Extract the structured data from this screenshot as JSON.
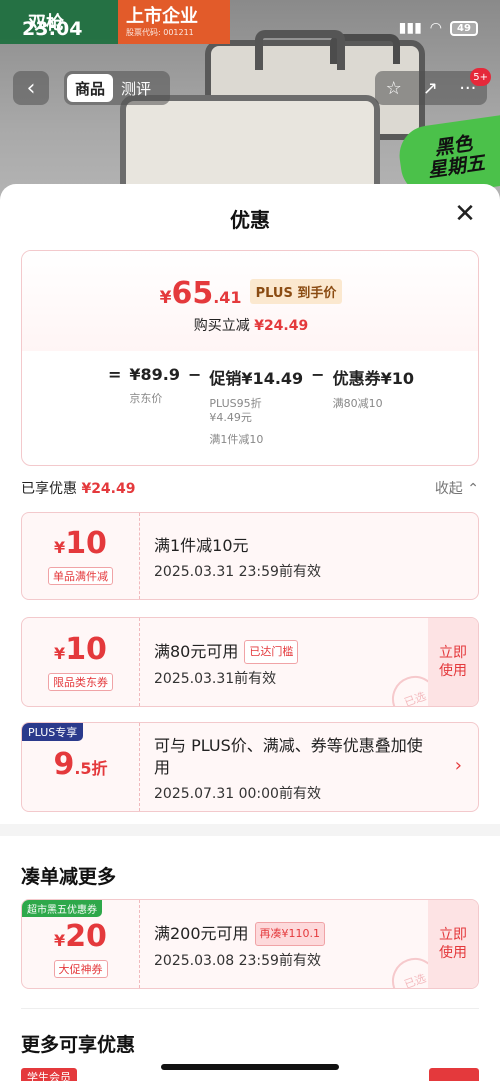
{
  "status": {
    "time": "23:04",
    "battery": "49"
  },
  "brand": {
    "name": "双枪",
    "listed": "上市企业",
    "stock_code": "股票代码: 001211"
  },
  "nav": {
    "tabs": [
      "商品",
      "测评"
    ],
    "badge": "5+"
  },
  "promo": {
    "line1": "黑色",
    "line2": "星期五"
  },
  "sheet": {
    "title": "优惠",
    "close": "✕"
  },
  "summary": {
    "final_cur": "¥",
    "final_int": "65",
    "final_dec": ".41",
    "plus_label": "PLUS 到手价",
    "instant_label": "购买立减",
    "instant_amount": "¥24.49",
    "formula": {
      "eq": "=",
      "price": "¥89.9",
      "price_label": "京东价",
      "minus1": "−",
      "promo": "促销¥14.49",
      "promo_sub1": "PLUS95折",
      "promo_sub2": "¥4.49元",
      "promo_sub3": "满1件减10",
      "minus2": "−",
      "coupon": "优惠券¥10",
      "coupon_sub": "满80减10"
    }
  },
  "enjoyed": {
    "label": "已享优惠",
    "amount": "¥24.49",
    "collapse": "收起 ⌃"
  },
  "coupons": [
    {
      "cur": "¥",
      "value": "10",
      "tag": "单品满件减",
      "main": "满1件减10元",
      "date": "2025.03.31 23:59前有效"
    },
    {
      "cur": "¥",
      "value": "10",
      "tag": "限品类东券",
      "main": "满80元可用",
      "reached": "已达门槛",
      "date": "2025.03.31前有效",
      "action": "立即使用",
      "stamp": "已选"
    },
    {
      "plus_badge": "PLUS专享",
      "value": "9",
      "suffix": ".5折",
      "main": "可与 PLUS价、满减、券等优惠叠加使用",
      "date": "2025.07.31 00:00前有效",
      "chevron": "›"
    }
  ],
  "more": {
    "title": "凑单减更多",
    "coupon": {
      "green_tag": "超市黑五优惠券",
      "cur": "¥",
      "value": "20",
      "tag": "大促神券",
      "main": "满200元可用",
      "addon": "再凑¥110.1",
      "date": "2025.03.08 23:59前有效",
      "action": "立即使用",
      "stamp": "已选"
    }
  },
  "extra": {
    "title": "更多可享优惠",
    "student_tag": "学生会员"
  }
}
